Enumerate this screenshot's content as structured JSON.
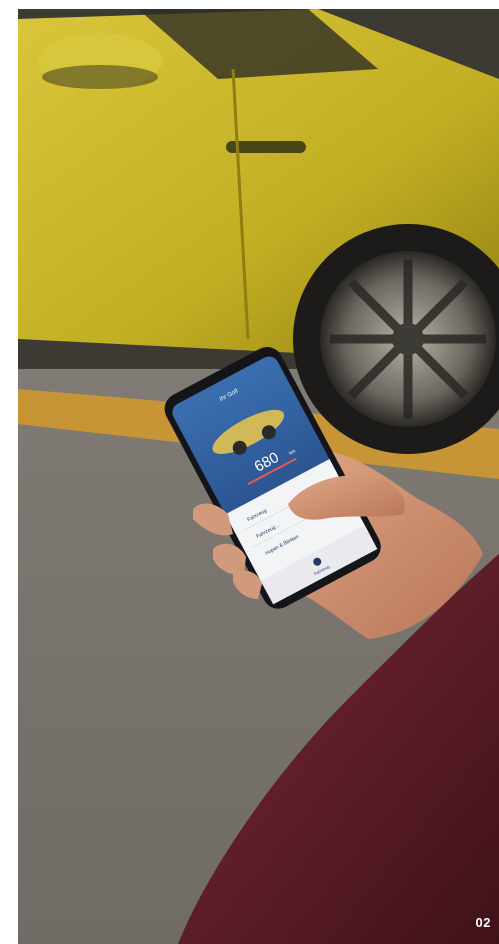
{
  "photo": {
    "subject": "hand-holding-smartphone-next-to-yellow-car",
    "car_color": "#c9b52a",
    "road_marking_color": "#d39a2a",
    "sleeve_color": "#5e1f2b"
  },
  "phone_app": {
    "title": "Ihr Golf",
    "range_value": "680",
    "range_unit": "km",
    "menu_items": [
      {
        "label": "Fahrzeug"
      },
      {
        "label": "Fahrzeug ..."
      },
      {
        "label": "Hupen & Blinken"
      }
    ],
    "tab_label": "Fahrzeug"
  },
  "page": {
    "number": "02"
  }
}
